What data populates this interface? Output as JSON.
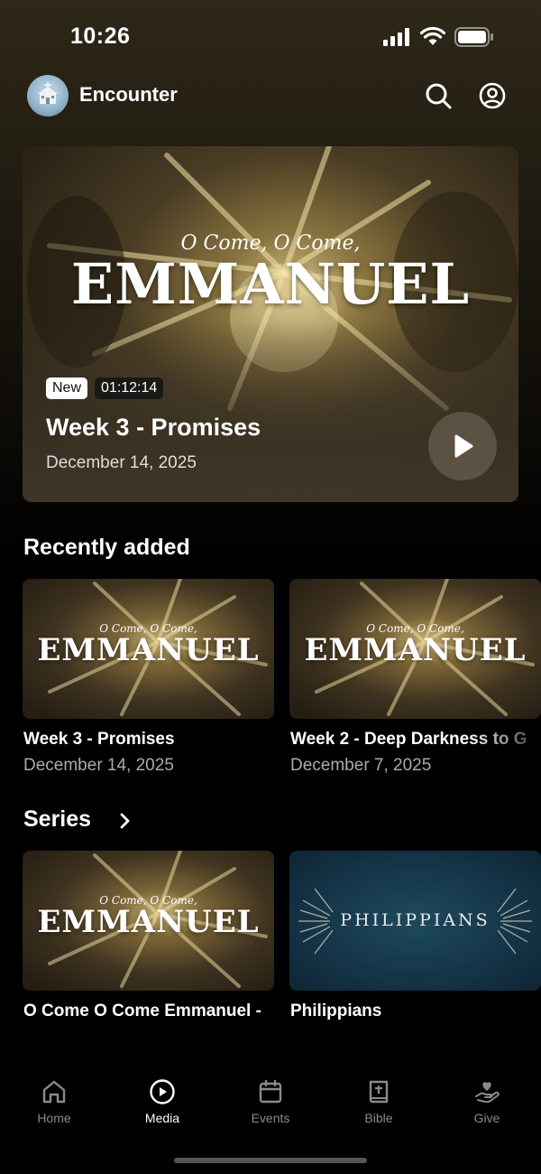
{
  "status_bar": {
    "time": "10:26"
  },
  "header": {
    "app_name": "Encounter"
  },
  "hero": {
    "art_small": "O Come, O Come,",
    "art_big": "EMMANUEL",
    "badge_new": "New",
    "duration": "01:12:14",
    "title": "Week 3 - Promises",
    "date": "December 14, 2025"
  },
  "recently_added": {
    "title": "Recently added",
    "items": [
      {
        "art_small": "O Come, O Come,",
        "art_big": "EMMANUEL",
        "title": "Week 3 - Promises",
        "date": "December 14, 2025"
      },
      {
        "art_small": "O Come, O Come,",
        "art_big": "EMMANUEL",
        "title": "Week 2 - Deep Darkness to G",
        "date": "December 7, 2025"
      }
    ]
  },
  "series": {
    "title": "Series",
    "items": [
      {
        "art_small": "O Come, O Come,",
        "art_big": "EMMANUEL",
        "title": "O Come O Come Emmanuel -"
      },
      {
        "art_word": "PHILIPPIANS",
        "title": "Philippians"
      }
    ]
  },
  "tabs": [
    {
      "label": "Home",
      "icon": "home-icon"
    },
    {
      "label": "Media",
      "icon": "play-circle-icon",
      "active": true
    },
    {
      "label": "Events",
      "icon": "calendar-icon"
    },
    {
      "label": "Bible",
      "icon": "bible-icon"
    },
    {
      "label": "Give",
      "icon": "give-heart-hand-icon"
    }
  ],
  "colors": {
    "background": "#000000",
    "active_tab": "#ffffff",
    "inactive_tab": "#8a8a8a"
  }
}
